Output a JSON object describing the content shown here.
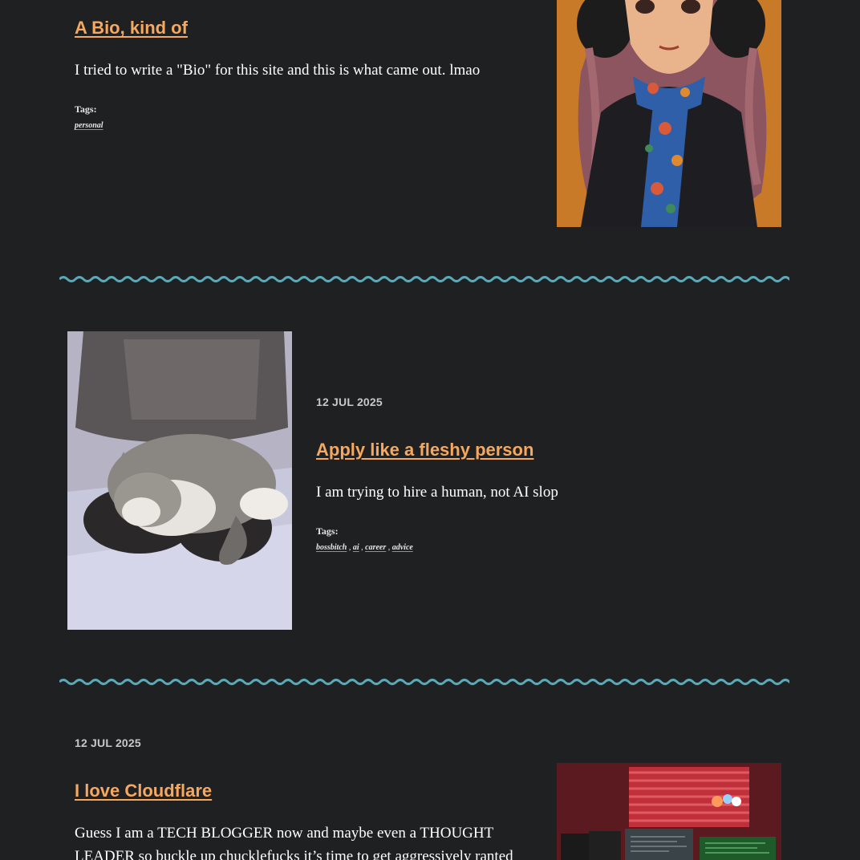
{
  "posts": [
    {
      "title": "A Bio, kind of",
      "excerpt": "I tried to write a \"Bio\" for this site and this is what came out. lmao",
      "tags_label": "Tags:",
      "tags": [
        "personal"
      ]
    },
    {
      "date": "12 JUL 2025",
      "title": "Apply like a fleshy person",
      "excerpt": "I am trying to hire a human, not AI slop",
      "tags_label": "Tags:",
      "tags": [
        "bossbitch",
        "ai",
        "career",
        "advice"
      ]
    },
    {
      "date": "12 JUL 2025",
      "title": "I love Cloudflare",
      "excerpt": "Guess I am a TECH BLOGGER now and maybe even a THOUGHT LEADER so buckle up chucklefucks it’s time to get aggressively ranted at"
    }
  ],
  "tag_separator": ",",
  "colors": {
    "background": "#1f2022",
    "title_link": "#f6a85f",
    "divider_wave": "#5aa9b8",
    "text": "#ffffff",
    "date": "#c8c8c8"
  }
}
